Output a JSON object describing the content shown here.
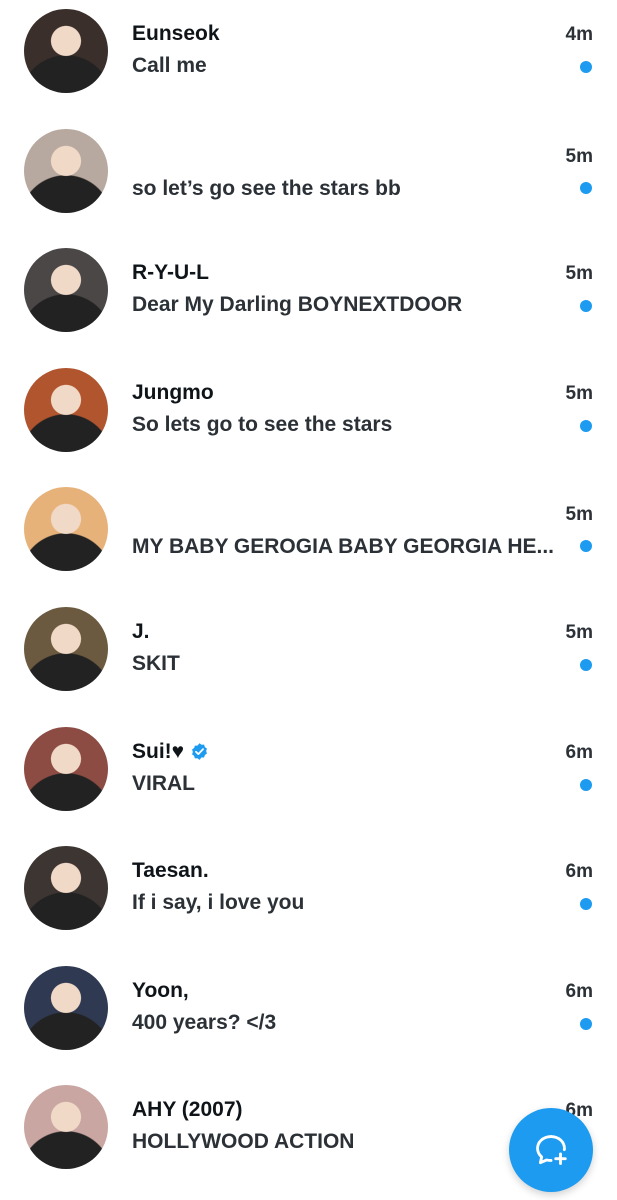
{
  "conversations": [
    {
      "name": "Eunseok",
      "message": "Call me",
      "time": "4m",
      "unread": true,
      "verified": false,
      "avatar_color": "#3a2f2a"
    },
    {
      "name": "",
      "message": "so let’s go see the stars bb",
      "time": "5m",
      "unread": true,
      "verified": false,
      "avatar_color": "#b8a9a0"
    },
    {
      "name": "R-Y-U-L",
      "message": "Dear My Darling BOYNEXTDOOR",
      "time": "5m",
      "unread": true,
      "verified": false,
      "avatar_color": "#4a4746"
    },
    {
      "name": "Jungmo",
      "message": "So lets go to see the stars",
      "time": "5m",
      "unread": true,
      "verified": false,
      "avatar_color": "#b0552e"
    },
    {
      "name": "",
      "message": "MY BABY GEROGIA BABY GEORGIA HE...",
      "time": "5m",
      "unread": true,
      "verified": false,
      "avatar_color": "#e7b27a"
    },
    {
      "name": "J.",
      "message": "SKIT",
      "time": "5m",
      "unread": true,
      "verified": false,
      "avatar_color": "#6b5a3f"
    },
    {
      "name": "Sui!♥",
      "message": "VIRAL",
      "time": "6m",
      "unread": true,
      "verified": true,
      "avatar_color": "#8c4b43"
    },
    {
      "name": "Taesan.",
      "message": "If i say, i love you",
      "time": "6m",
      "unread": true,
      "verified": false,
      "avatar_color": "#3d3532"
    },
    {
      "name": "Yoon,",
      "message": "400 years? </3",
      "time": "6m",
      "unread": true,
      "verified": false,
      "avatar_color": "#2f3a52"
    },
    {
      "name": "AHY (2007)",
      "message": "HOLLYWOOD ACTION",
      "time": "6m",
      "unread": false,
      "verified": false,
      "avatar_color": "#c9a6a2"
    }
  ],
  "fab": {
    "icon": "new-message-icon"
  },
  "colors": {
    "accent": "#1d9bf0",
    "text": "#0f1419"
  }
}
